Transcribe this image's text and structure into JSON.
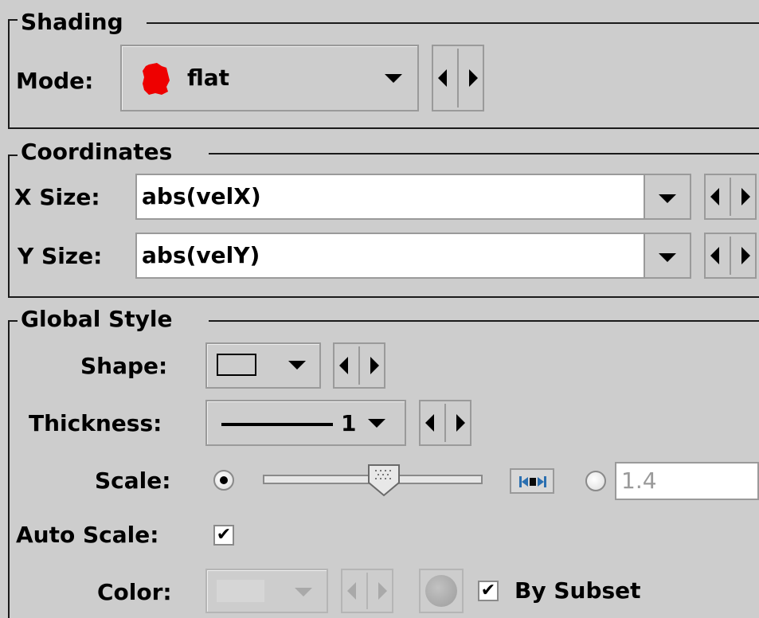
{
  "shading": {
    "title": "Shading",
    "mode_label": "Mode:",
    "mode_value": "flat",
    "mode_icon": "red-blob-icon",
    "mode_icon_color": "#ee0000"
  },
  "coordinates": {
    "title": "Coordinates",
    "x_label": "X Size:",
    "x_value": "abs(velX)",
    "y_label": "Y Size:",
    "y_value": "abs(velY)"
  },
  "global_style": {
    "title": "Global Style",
    "shape_label": "Shape:",
    "shape_icon": "open-rectangle-icon",
    "thickness_label": "Thickness:",
    "thickness_value": "1",
    "scale_label": "Scale:",
    "scale_slider_level": 0.55,
    "scale_text_value": "1.4",
    "scale_slider_selected": true,
    "auto_scale_label": "Auto Scale:",
    "auto_scale_checked": true,
    "color_label": "Color:",
    "by_subset_label": "By Subset",
    "by_subset_checked": true,
    "accent_color": "#2b6fb0"
  }
}
